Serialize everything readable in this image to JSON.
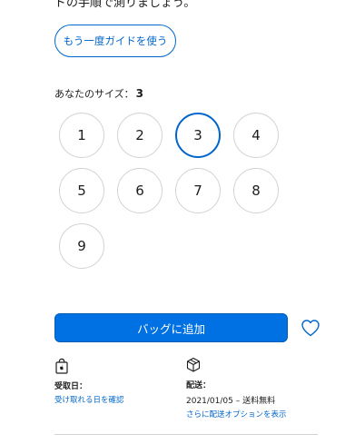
{
  "top_text": "ドの手順で測りましょう。",
  "guide_button": "もう一度ガイドを使う",
  "size_summary": {
    "label": "あなたのサイズ：",
    "value": "3"
  },
  "sizes": [
    "1",
    "2",
    "3",
    "4",
    "5",
    "6",
    "7",
    "8",
    "9"
  ],
  "selected_size": "3",
  "add_to_bag": "バッグに追加",
  "pickup": {
    "label": "受取日：",
    "link": "受け取れる日を確認"
  },
  "delivery": {
    "label": "配送：",
    "info": "2021/01/05 – 送料無料",
    "link": "さらに配送オプションを表示"
  },
  "colors": {
    "accent": "#0066cc",
    "button_bg": "#0071e3",
    "border": "#d2d2d7"
  }
}
